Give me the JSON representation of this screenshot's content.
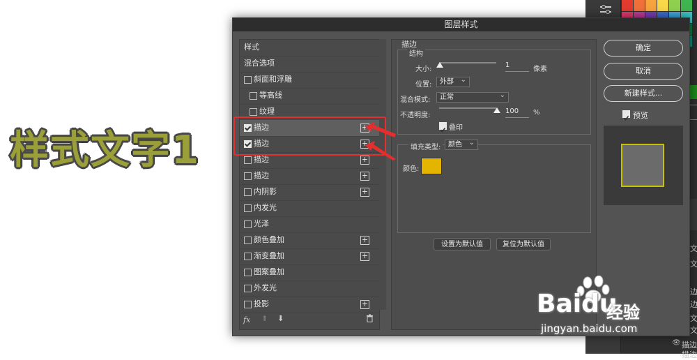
{
  "canvas": {
    "sample_text": "样式文字1"
  },
  "dialog": {
    "title": "图层样式",
    "styles": [
      {
        "label": "样式",
        "checkbox": false,
        "checked": false,
        "plus": false,
        "indent": "none"
      },
      {
        "label": "混合选项",
        "checkbox": false,
        "checked": false,
        "plus": false,
        "indent": "none"
      },
      {
        "label": "斜面和浮雕",
        "checkbox": true,
        "checked": false,
        "plus": false,
        "indent": "normal"
      },
      {
        "label": "等高线",
        "checkbox": true,
        "checked": false,
        "plus": false,
        "indent": "sub"
      },
      {
        "label": "纹理",
        "checkbox": true,
        "checked": false,
        "plus": false,
        "indent": "sub"
      },
      {
        "label": "描边",
        "checkbox": true,
        "checked": true,
        "plus": true,
        "indent": "normal",
        "selected": true
      },
      {
        "label": "描边",
        "checkbox": true,
        "checked": true,
        "plus": true,
        "indent": "normal"
      },
      {
        "label": "描边",
        "checkbox": true,
        "checked": false,
        "plus": true,
        "indent": "normal"
      },
      {
        "label": "描边",
        "checkbox": true,
        "checked": false,
        "plus": true,
        "indent": "normal"
      },
      {
        "label": "内阴影",
        "checkbox": true,
        "checked": false,
        "plus": true,
        "indent": "normal"
      },
      {
        "label": "内发光",
        "checkbox": true,
        "checked": false,
        "plus": false,
        "indent": "normal"
      },
      {
        "label": "光泽",
        "checkbox": true,
        "checked": false,
        "plus": false,
        "indent": "normal"
      },
      {
        "label": "颜色叠加",
        "checkbox": true,
        "checked": false,
        "plus": true,
        "indent": "normal"
      },
      {
        "label": "渐变叠加",
        "checkbox": true,
        "checked": false,
        "plus": true,
        "indent": "normal"
      },
      {
        "label": "图案叠加",
        "checkbox": true,
        "checked": false,
        "plus": false,
        "indent": "normal"
      },
      {
        "label": "外发光",
        "checkbox": true,
        "checked": false,
        "plus": false,
        "indent": "normal"
      },
      {
        "label": "投影",
        "checkbox": true,
        "checked": false,
        "plus": true,
        "indent": "normal"
      }
    ],
    "footer": {
      "fx_label": "fx",
      "up_icon": "arrow-up-icon",
      "down_icon": "arrow-down-icon",
      "trash_icon": "trash-icon"
    },
    "stroke": {
      "section_title": "描边",
      "structure_title": "结构",
      "size_label": "大小:",
      "size_value": "1",
      "size_unit": "像素",
      "size_slider_fraction": 0.0,
      "position_label": "位置:",
      "position_value": "外部",
      "blend_label": "混合模式:",
      "blend_value": "正常",
      "opacity_label": "不透明度:",
      "opacity_value": "100",
      "opacity_unit": "%",
      "opacity_slider_fraction": 1.0,
      "overprint_label": "叠印",
      "overprint_checked": true,
      "fill_type_label": "填充类型:",
      "fill_type_value": "颜色",
      "color_label": "颜色:",
      "color_hex": "#e3b400",
      "set_default": "设置为默认值",
      "reset_default": "复位为默认值"
    },
    "buttons": {
      "ok": "确定",
      "cancel": "取消",
      "new_style": "新建样式...",
      "preview_label": "预览",
      "preview_checked": true
    },
    "colors": {
      "highlight": "#e52e2e",
      "stroke_preview": "#c7c300"
    }
  },
  "ps_side": {
    "panel_texts": [
      "文",
      "文",
      "边",
      "文",
      "边",
      "文",
      "描边",
      "描边"
    ]
  },
  "watermark": {
    "brand": "Bai",
    "brand_du": "du",
    "jingyan": "经验",
    "url": "jingyan.baidu.com"
  }
}
